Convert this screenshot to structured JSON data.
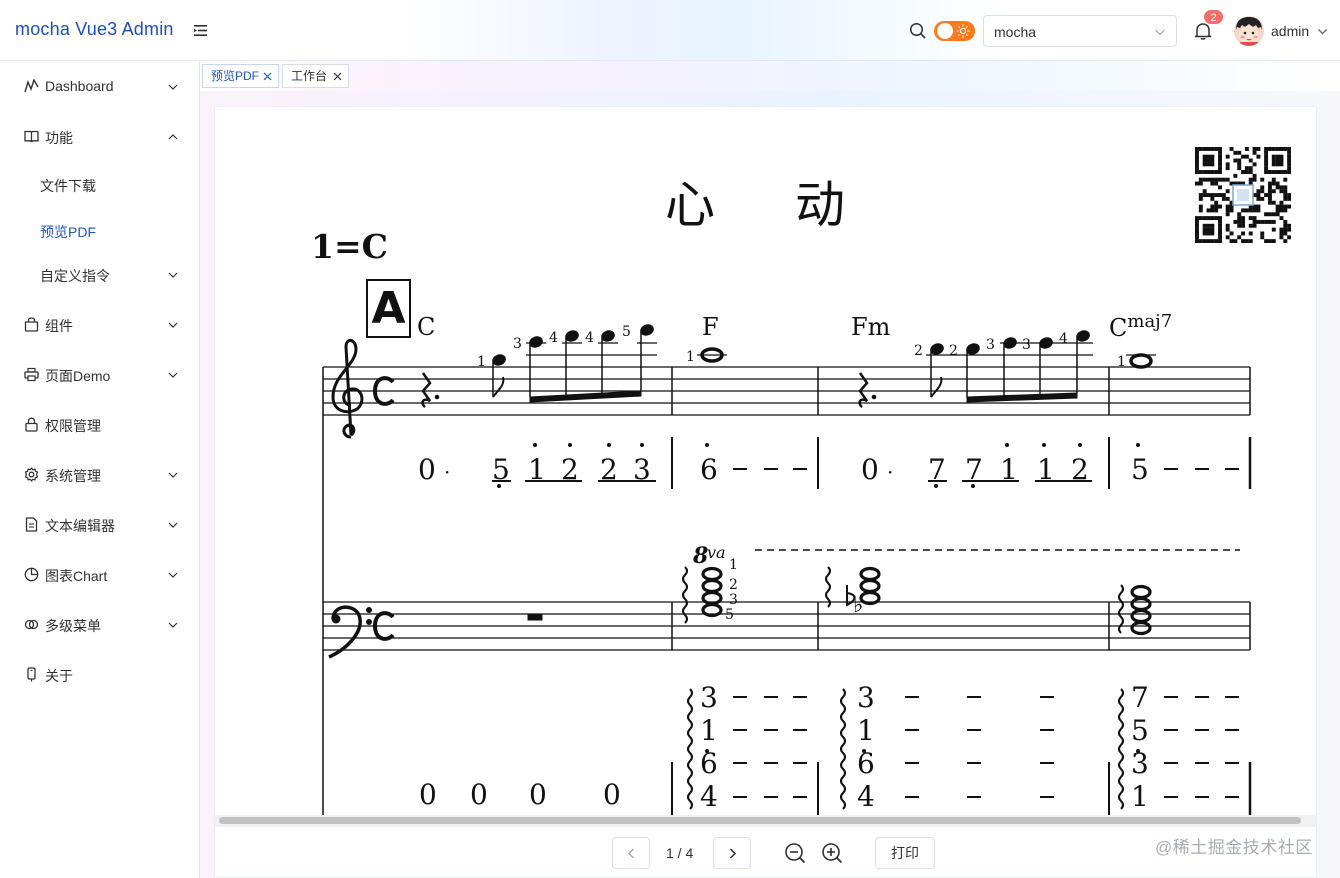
{
  "app": {
    "title": "mocha Vue3 Admin"
  },
  "header": {
    "select_value": "mocha",
    "notification_count": "2",
    "user_name": "admin"
  },
  "sidebar": {
    "items": [
      {
        "label": "Dashboard",
        "icon": "trend-icon"
      },
      {
        "label": "功能",
        "icon": "book-icon",
        "expanded": true,
        "children": [
          {
            "label": "文件下载"
          },
          {
            "label": "预览PDF",
            "active": true
          },
          {
            "label": "自定义指令"
          }
        ]
      },
      {
        "label": "组件",
        "icon": "bag-icon"
      },
      {
        "label": "页面Demo",
        "icon": "printer-icon"
      },
      {
        "label": "权限管理",
        "icon": "lock-icon"
      },
      {
        "label": "系统管理",
        "icon": "gear-icon"
      },
      {
        "label": "文本编辑器",
        "icon": "document-icon"
      },
      {
        "label": "图表Chart",
        "icon": "pie-chart-icon"
      },
      {
        "label": "多级菜单",
        "icon": "link-icon"
      },
      {
        "label": "关于",
        "icon": "phone-icon"
      }
    ]
  },
  "tags": [
    {
      "label": "预览PDF",
      "active": true
    },
    {
      "label": "工作台",
      "active": false
    }
  ],
  "pdf": {
    "title": "心动",
    "key": "1=C",
    "rehearsal_mark": "A",
    "chords": [
      "C",
      "F",
      "Fm",
      "Cmaj7"
    ],
    "page_info": "1 / 4",
    "print_label": "打印"
  },
  "watermark": "@稀土掘金技术社区",
  "colors": {
    "accent": "#1f57c3",
    "toggle": "#ff7a1a",
    "badge": "#f56c6c"
  }
}
